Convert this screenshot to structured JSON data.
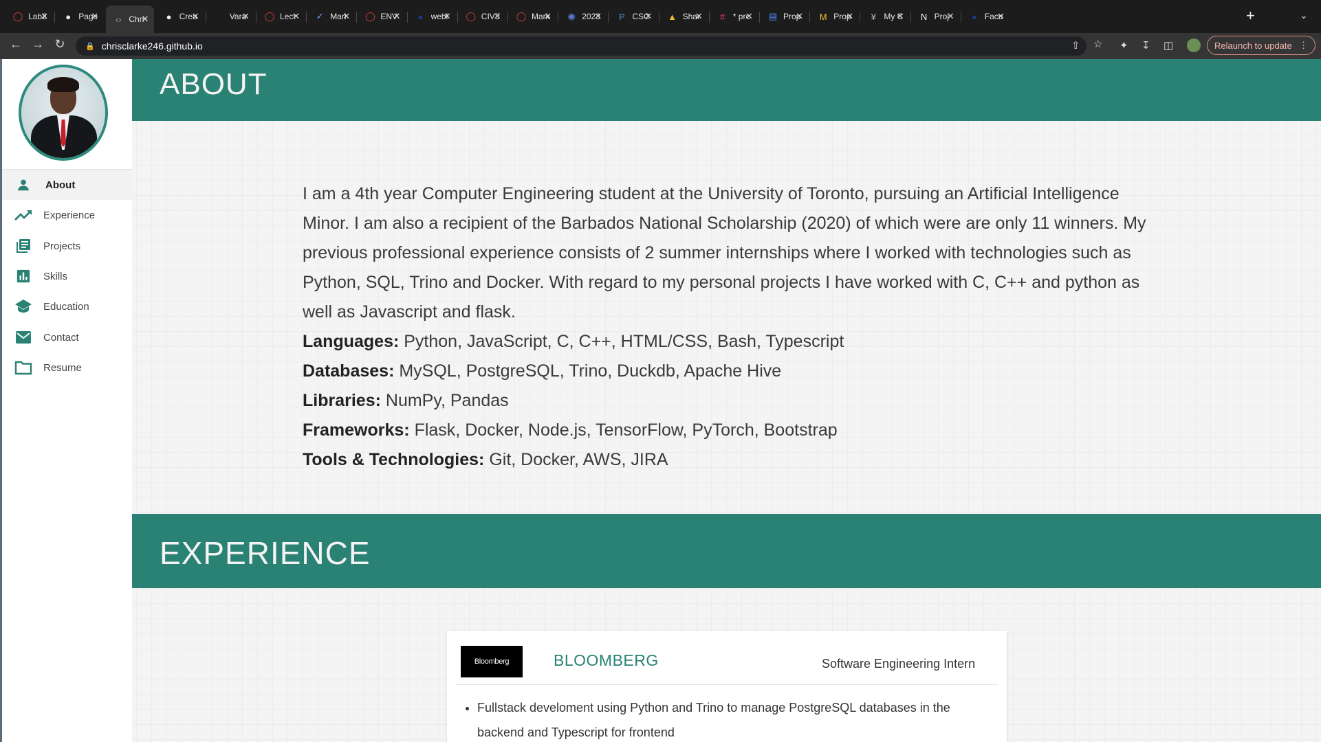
{
  "browser": {
    "tabs": [
      {
        "title": "Lab2",
        "icon": "red-ring-icon"
      },
      {
        "title": "Page",
        "icon": "github-icon"
      },
      {
        "title": "Chri",
        "icon": "code-icon",
        "active": true
      },
      {
        "title": "Crea",
        "icon": "github-icon"
      },
      {
        "title": "Vara",
        "icon": "blank-icon"
      },
      {
        "title": "Lect",
        "icon": "red-ring-icon"
      },
      {
        "title": "Marl",
        "icon": "check-icon"
      },
      {
        "title": "ENV",
        "icon": "red-ring-icon"
      },
      {
        "title": "webl",
        "icon": "dark-globe-icon"
      },
      {
        "title": "CIV3",
        "icon": "red-ring-icon"
      },
      {
        "title": "Mark",
        "icon": "red-ring-icon"
      },
      {
        "title": "2023",
        "icon": "blue-circle-icon"
      },
      {
        "title": "CSC",
        "icon": "p-icon"
      },
      {
        "title": "Shar",
        "icon": "drive-icon"
      },
      {
        "title": "* prc",
        "icon": "slack-icon"
      },
      {
        "title": "Prop",
        "icon": "docs-icon"
      },
      {
        "title": "Prop",
        "icon": "m-icon"
      },
      {
        "title": "My C",
        "icon": "n-icon"
      },
      {
        "title": "Proj",
        "icon": "notion-icon"
      },
      {
        "title": "Facu",
        "icon": "dark-globe-icon"
      }
    ],
    "url": "chrisclarke246.github.io",
    "relaunch_label": "Relaunch to update"
  },
  "sidebar": {
    "items": [
      {
        "label": "About",
        "icon": "person-icon",
        "active": true
      },
      {
        "label": "Experience",
        "icon": "trending-up-icon"
      },
      {
        "label": "Projects",
        "icon": "library-books-icon"
      },
      {
        "label": "Skills",
        "icon": "bar-chart-icon"
      },
      {
        "label": "Education",
        "icon": "school-icon"
      },
      {
        "label": "Contact",
        "icon": "mail-icon"
      },
      {
        "label": "Resume",
        "icon": "folder-icon"
      }
    ]
  },
  "about": {
    "heading": "ABOUT",
    "paragraph": "I am a 4th year Computer Engineering student at the University of Toronto, pursuing an Artificial Intelligence Minor. I am also a recipient of the Barbados National Scholarship (2020) of which were are only 11 winners. My previous professional experience consists of 2 summer internships where I worked with technologies such as Python, SQL, Trino and Docker. With regard to my personal projects I have worked with C, C++ and python as well as Javascript and flask.",
    "skills": [
      {
        "label": "Languages:",
        "value": "Python, JavaScript, C, C++, HTML/CSS, Bash, Typescript"
      },
      {
        "label": "Databases:",
        "value": "MySQL, PostgreSQL, Trino, Duckdb, Apache Hive"
      },
      {
        "label": "Libraries:",
        "value": "NumPy, Pandas"
      },
      {
        "label": "Frameworks:",
        "value": "Flask, Docker, Node.js, TensorFlow, PyTorch, Bootstrap"
      },
      {
        "label": "Tools & Technologies:",
        "value": "Git, Docker, AWS, JIRA"
      }
    ]
  },
  "experience": {
    "heading": "EXPERIENCE",
    "card": {
      "logo_text": "Bloomberg",
      "company": "BLOOMBERG",
      "role": "Software Engineering Intern",
      "bullets": [
        "Fullstack develoment using Python and Trino to manage PostgreSQL databases in the backend and Typescript for frontend"
      ]
    }
  },
  "colors": {
    "accent": "#2a8274",
    "tab_strip": "#1c1c1c",
    "toolbar": "#353535",
    "relaunch": "#f0b7ae"
  }
}
